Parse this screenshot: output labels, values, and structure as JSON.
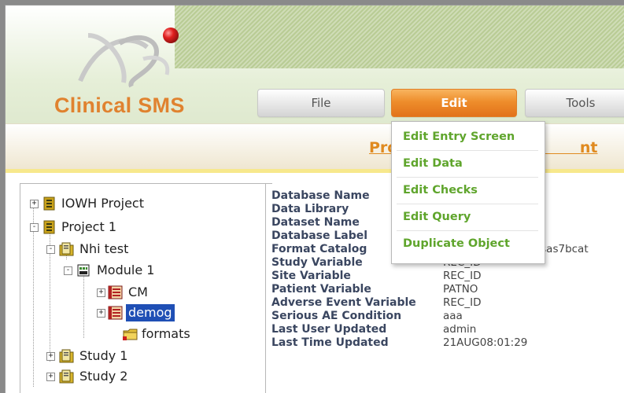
{
  "app": {
    "name": "Clinical SMS"
  },
  "menubar": {
    "items": [
      {
        "label": "File",
        "active": false
      },
      {
        "label": "Edit",
        "active": true
      },
      {
        "label": "Tools",
        "active": false
      }
    ]
  },
  "page_title_visible": "Pro                                   nt",
  "edit_menu": {
    "items": [
      "Edit Entry Screen",
      "Edit Data",
      "Edit Checks",
      "Edit Query",
      "Duplicate Object"
    ]
  },
  "tree": {
    "nodes": [
      {
        "label": "IOWH Project",
        "icon": "project-icon",
        "expander": "+"
      },
      {
        "label": "Project 1",
        "icon": "project-icon",
        "expander": "-"
      },
      {
        "label": "Nhi test",
        "icon": "study-icon",
        "expander": "-"
      },
      {
        "label": "Module 1",
        "icon": "module-icon",
        "expander": "-"
      },
      {
        "label": "CM",
        "icon": "dataset-icon",
        "expander": "+"
      },
      {
        "label": "demog",
        "icon": "dataset-icon",
        "expander": "+",
        "selected": true
      },
      {
        "label": "formats",
        "icon": "folder-icon"
      },
      {
        "label": "Study 1",
        "icon": "study-icon",
        "expander": "+"
      },
      {
        "label": "Study 2",
        "icon": "study-icon",
        "expander": "+"
      }
    ]
  },
  "details": {
    "rows": [
      {
        "label": "Database Name",
        "value": ""
      },
      {
        "label": "Data Library",
        "value": ""
      },
      {
        "label": "Dataset Name",
        "value": ""
      },
      {
        "label": "Database Label",
        "value": ""
      },
      {
        "label": "Format Catalog",
        "value": "P1\\S1\\M1\\formats.sas7bcat"
      },
      {
        "label": "Study Variable",
        "value": "REC_ID"
      },
      {
        "label": "Site Variable",
        "value": "REC_ID"
      },
      {
        "label": "Patient Variable",
        "value": "PATNO"
      },
      {
        "label": "Adverse Event Variable",
        "value": "REC_ID"
      },
      {
        "label": "Serious AE Condition",
        "value": "aaa"
      },
      {
        "label": "Last User Updated",
        "value": "admin"
      },
      {
        "label": "Last Time Updated",
        "value": "21AUG08:01:29"
      }
    ]
  },
  "colors": {
    "brand_orange": "#e0822f",
    "menu_green": "#5fa52c",
    "selection_blue": "#1f4fb5",
    "label_navy": "#3a4660"
  }
}
